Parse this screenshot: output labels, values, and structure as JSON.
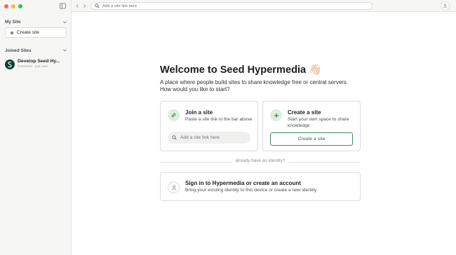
{
  "sidebar": {
    "my_site_title": "My Site",
    "create_site_label": "Create site",
    "joined_sites_title": "Joined Sites",
    "joined_items": [
      {
        "name": "Develop Seed Hy...",
        "meta": "Comment · just now",
        "avatar_letter": "S"
      }
    ]
  },
  "topbar": {
    "search_placeholder": "Add a site link here"
  },
  "main": {
    "welcome_title": "Welcome to Seed Hypermedia 👋🏻",
    "subtitle": "A place where people build sites to share knowledge free or central servers. How would you like to start?",
    "join_card": {
      "title": "Join a site",
      "description": "Paste a site link in the bar above",
      "input_placeholder": "Add a site link here"
    },
    "create_card": {
      "title": "Create a site",
      "description": "Start your own space to share knowledge",
      "button_label": "Create a site"
    },
    "divider_text": "already have an identity?",
    "signin_card": {
      "title": "Sign in to Hypermedia or create an account",
      "description": "Bring your existing identity to this device or create a new identity"
    }
  },
  "colors": {
    "accent_green": "#3f8f5a",
    "icon_bg_green": "#dcefdf",
    "site_avatar": "#0f3d33"
  },
  "icons": [
    "sidebar-toggle-icon",
    "chevron-down-icon",
    "plus-icon",
    "back-arrow-icon",
    "forward-arrow-icon",
    "search-icon",
    "user-icon",
    "link-icon"
  ]
}
